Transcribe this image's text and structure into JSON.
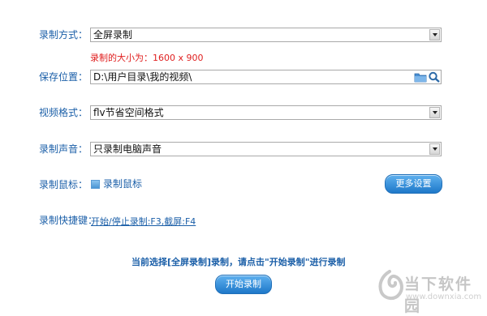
{
  "record_mode": {
    "label": "录制方式：",
    "value": "全屏录制"
  },
  "size_note": {
    "prefix": "录制的大小为：",
    "value": "1600 x 900"
  },
  "save_location": {
    "label": "保存位置：",
    "value": "D:\\用户目录\\我的视频\\"
  },
  "video_format": {
    "label": "视频格式：",
    "value": "flv节省空间格式"
  },
  "record_audio": {
    "label": "录制声音：",
    "value": "只录制电脑声音"
  },
  "record_mouse": {
    "label": "录制鼠标：",
    "checkbox_label": "录制鼠标"
  },
  "more_settings_label": "更多设置",
  "shortcuts": {
    "label": "录制快捷键：",
    "value": "开始/停止录制:F3,截屏:F4"
  },
  "status_message": "当前选择[全屏录制]录制，请点击\"开始录制\"进行录制",
  "start_button_label": "开始录制",
  "watermark": {
    "text": "当下软件园",
    "url": "www.downxia.com"
  },
  "colors": {
    "label_blue": "#1b5fa8",
    "note_red": "#e02020",
    "button_blue": "#2a88d8"
  }
}
